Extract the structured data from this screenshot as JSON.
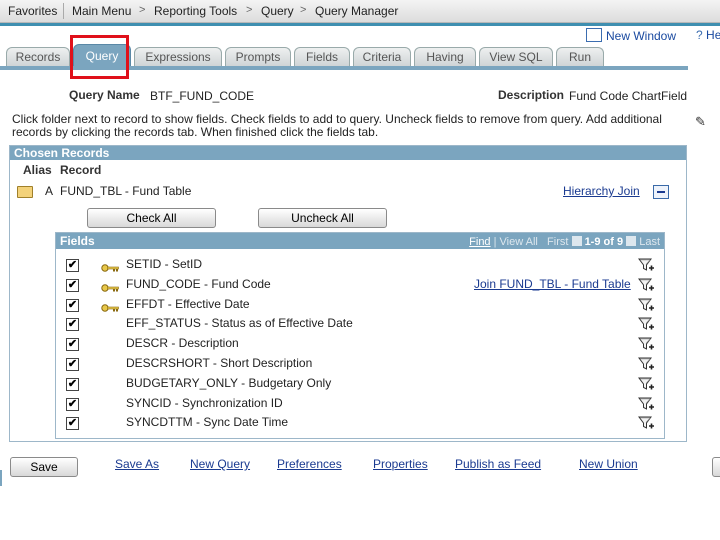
{
  "topnav": {
    "items": [
      "Favorites",
      "Main Menu",
      "Reporting Tools",
      "Query",
      "Query Manager"
    ]
  },
  "header_links": {
    "new_window": "New Window",
    "help": "He"
  },
  "tabs": [
    "Records",
    "Query",
    "Expressions",
    "Prompts",
    "Fields",
    "Criteria",
    "Having",
    "View SQL",
    "Run"
  ],
  "active_tab": "Query",
  "query": {
    "name_label": "Query Name",
    "name_value": "BTF_FUND_CODE",
    "desc_label": "Description",
    "desc_value": "Fund Code ChartField"
  },
  "instructions": "Click folder next to record to show fields. Check fields to add to query. Uncheck fields to remove from query. Add additional records by clicking the records tab. When finished click the fields tab.",
  "chosen": {
    "title": "Chosen Records",
    "col_alias": "Alias",
    "col_record": "Record",
    "alias": "A",
    "record": "FUND_TBL - Fund Table",
    "hierarchy_join": "Hierarchy Join",
    "check_all": "Check All",
    "uncheck_all": "Uncheck All"
  },
  "fields": {
    "title": "Fields",
    "find": "Find",
    "view_all": "View All",
    "first": "First",
    "range": "1-9 of 9",
    "last": "Last",
    "rows": [
      {
        "name": "SETID - SetID",
        "key": true,
        "checked": true,
        "link": ""
      },
      {
        "name": "FUND_CODE - Fund Code",
        "key": true,
        "checked": true,
        "link": "Join FUND_TBL - Fund Table"
      },
      {
        "name": "EFFDT - Effective Date",
        "key": true,
        "checked": true,
        "link": ""
      },
      {
        "name": "EFF_STATUS - Status as of Effective Date",
        "key": false,
        "checked": true,
        "link": ""
      },
      {
        "name": "DESCR - Description",
        "key": false,
        "checked": true,
        "link": ""
      },
      {
        "name": "DESCRSHORT - Short Description",
        "key": false,
        "checked": true,
        "link": ""
      },
      {
        "name": "BUDGETARY_ONLY - Budgetary Only",
        "key": false,
        "checked": true,
        "link": ""
      },
      {
        "name": "SYNCID - Synchronization ID",
        "key": false,
        "checked": true,
        "link": ""
      },
      {
        "name": "SYNCDTTM - Sync Date Time",
        "key": false,
        "checked": true,
        "link": ""
      }
    ]
  },
  "bottom": {
    "save": "Save",
    "save_as": "Save As",
    "new_query": "New Query",
    "preferences": "Preferences",
    "properties": "Properties",
    "publish_as_feed": "Publish as Feed",
    "new_union": "New Union"
  },
  "colors": {
    "accent": "#7ba5bf",
    "link": "#1a3a90",
    "highlight": "#e0101a"
  }
}
